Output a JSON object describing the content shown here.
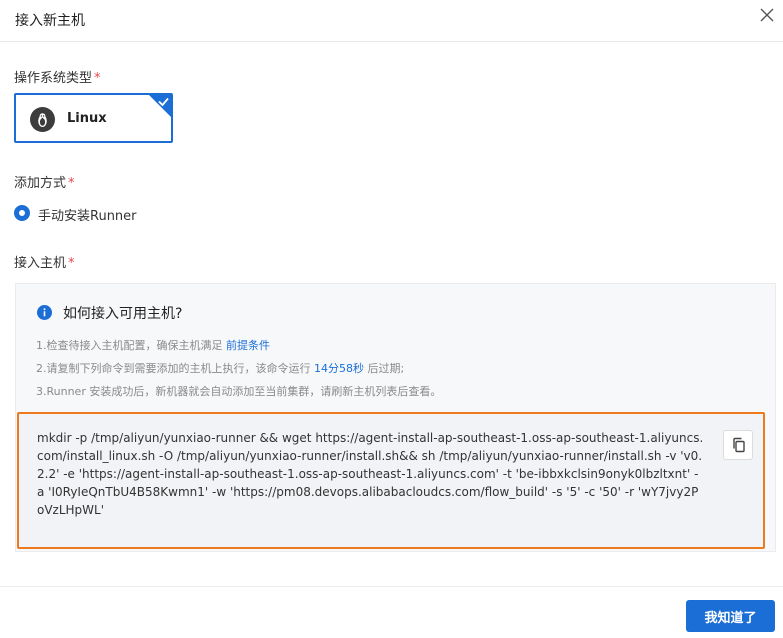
{
  "dialog": {
    "title": "接入新主机",
    "close_icon": "close-icon"
  },
  "os_type": {
    "label": "操作系统类型",
    "required_mark": "*",
    "selected": "Linux",
    "icon": "linux-penguin-icon"
  },
  "add_method": {
    "label": "添加方式",
    "required_mark": "*",
    "option": "手动安装Runner",
    "selected": true
  },
  "host": {
    "label": "接入主机",
    "required_mark": "*"
  },
  "guide": {
    "title": "如何接入可用主机?",
    "step1_text": "1.检查待接入主机配置，确保主机满足 ",
    "step1_link": "前提条件",
    "step2_text": "2.请复制下列命令到需要添加的主机上执行，该命令运行 ",
    "step2_time": "14分58秒",
    "step2_suffix": " 后过期;",
    "step3_text": "3.Runner 安装成功后，新机器就会自动添加至当前集群，请刷新主机列表后查看。"
  },
  "command": {
    "text": "mkdir -p /tmp/aliyun/yunxiao-runner && wget https://agent-install-ap-southeast-1.oss-ap-southeast-1.aliyuncs.com/install_linux.sh -O /tmp/aliyun/yunxiao-runner/install.sh&& sh /tmp/aliyun/yunxiao-runner/install.sh -v 'v0.2.2' -e 'https://agent-install-ap-southeast-1.oss-ap-southeast-1.aliyuncs.com' -t 'be-ibbxkclsin9onyk0lbzltxnt' -a 'I0RyIeQnTbU4B58Kwmn1' -w 'https://pm08.devops.alibabacloudcs.com/flow_build' -s '5' -c '50' -r 'wY7jvy2PoVzLHpWL'",
    "copy_icon": "copy-icon"
  },
  "footer": {
    "confirm_label": "我知道了"
  },
  "colors": {
    "primary": "#1b6ed6",
    "highlight_border": "#ee7a20",
    "required": "#e5484d"
  }
}
